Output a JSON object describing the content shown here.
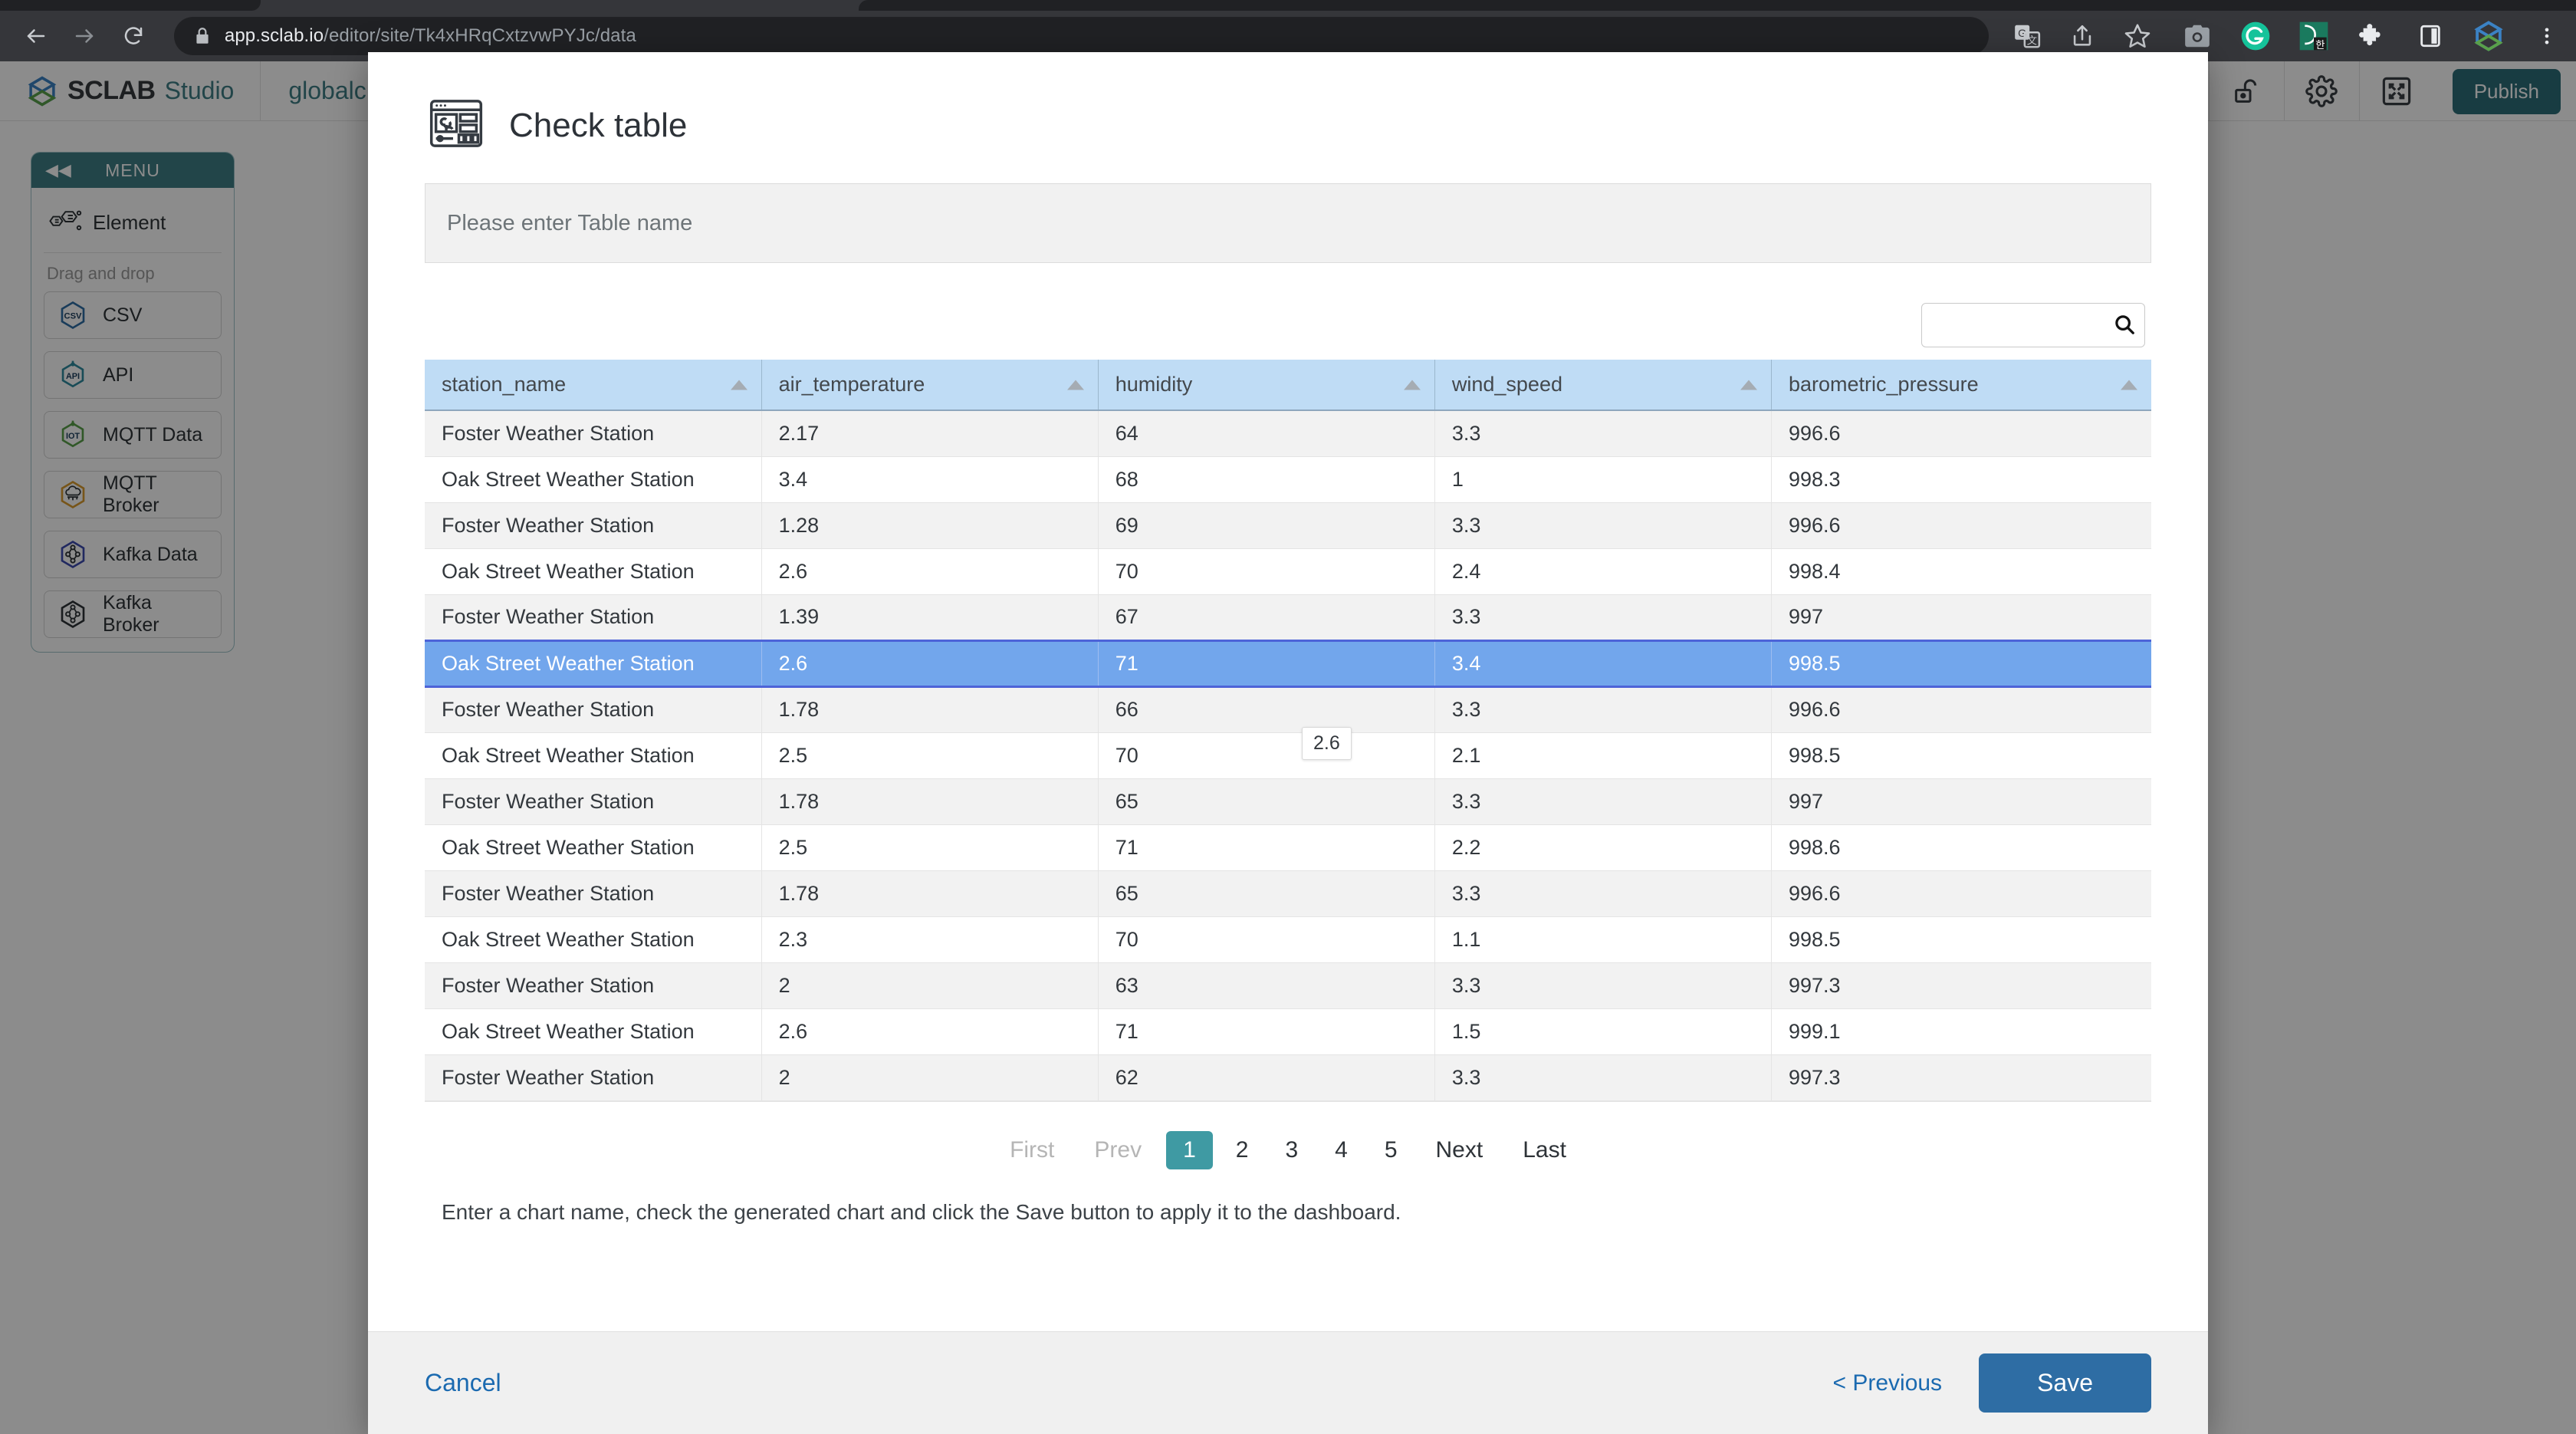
{
  "browser": {
    "url_host": "app.sclab.io",
    "url_path": "/editor/site/Tk4xHRqCxtzvwPYJc/data",
    "nav": {
      "back": "←",
      "forward": "→",
      "reload": "⟳"
    },
    "icons": {
      "lock": "lock-icon",
      "translate": "translate-icon",
      "share": "share-icon",
      "bookmark": "star-icon",
      "screenshot": "camera-icon",
      "grammarly": "grammarly-icon",
      "korean": "korean-ime-icon",
      "extensions": "puzzle-icon",
      "sidepanel": "side-panel-icon",
      "sclab": "sclab-logo-icon",
      "menu": "kebab-menu-icon"
    }
  },
  "app": {
    "brand_name": "SCLAB",
    "brand_sub": "Studio",
    "site_name": "globalc",
    "publish_label": "Publish",
    "header_icons": [
      "share-icon",
      "unlock-icon",
      "gear-icon",
      "fullscreen-icon"
    ]
  },
  "menu": {
    "title": "MENU",
    "collapse_icon": "◀◀",
    "element_label": "Element",
    "drag_label": "Drag and drop",
    "items": [
      {
        "label": "CSV",
        "icon": "csv-hex-icon",
        "color": "#2e6da4"
      },
      {
        "label": "API",
        "icon": "api-hex-icon",
        "color": "#2e8a9e"
      },
      {
        "label": "MQTT Data",
        "icon": "iot-hex-icon",
        "color": "#5aa04a"
      },
      {
        "label": "MQTT Broker",
        "icon": "mqtt-broker-hex-icon",
        "color": "#d99b2e"
      },
      {
        "label": "Kafka Data",
        "icon": "kafka-hex-icon",
        "color": "#3d4bb0"
      },
      {
        "label": "Kafka Broker",
        "icon": "kafka-hex-icon",
        "color": "#2e3338"
      }
    ]
  },
  "modal": {
    "title": "Check table",
    "title_icon": "dashboard-layout-icon",
    "table_name_placeholder": "Please enter Table name",
    "table_name_value": "",
    "search_placeholder": "",
    "search_value": "",
    "search_icon": "search-icon",
    "helper_text": "Enter a chart name, check the generated chart and click the Save button to apply it to the dashboard.",
    "tooltip_value": "2.6",
    "footer": {
      "cancel_label": "Cancel",
      "previous_label": "< Previous",
      "save_label": "Save"
    }
  },
  "table": {
    "columns": [
      "station_name",
      "air_temperature",
      "humidity",
      "wind_speed",
      "barometric_pressure"
    ],
    "selected_row_index": 5,
    "rows": [
      [
        "Foster Weather Station",
        "2.17",
        "64",
        "3.3",
        "996.6"
      ],
      [
        "Oak Street Weather Station",
        "3.4",
        "68",
        "1",
        "998.3"
      ],
      [
        "Foster Weather Station",
        "1.28",
        "69",
        "3.3",
        "996.6"
      ],
      [
        "Oak Street Weather Station",
        "2.6",
        "70",
        "2.4",
        "998.4"
      ],
      [
        "Foster Weather Station",
        "1.39",
        "67",
        "3.3",
        "997"
      ],
      [
        "Oak Street Weather Station",
        "2.6",
        "71",
        "3.4",
        "998.5"
      ],
      [
        "Foster Weather Station",
        "1.78",
        "66",
        "3.3",
        "996.6"
      ],
      [
        "Oak Street Weather Station",
        "2.5",
        "70",
        "2.1",
        "998.5"
      ],
      [
        "Foster Weather Station",
        "1.78",
        "65",
        "3.3",
        "997"
      ],
      [
        "Oak Street Weather Station",
        "2.5",
        "71",
        "2.2",
        "998.6"
      ],
      [
        "Foster Weather Station",
        "1.78",
        "65",
        "3.3",
        "996.6"
      ],
      [
        "Oak Street Weather Station",
        "2.3",
        "70",
        "1.1",
        "998.5"
      ],
      [
        "Foster Weather Station",
        "2",
        "63",
        "3.3",
        "997.3"
      ],
      [
        "Oak Street Weather Station",
        "2.6",
        "71",
        "1.5",
        "999.1"
      ],
      [
        "Foster Weather Station",
        "2",
        "62",
        "3.3",
        "997.3"
      ]
    ]
  },
  "pagination": {
    "first_label": "First",
    "prev_label": "Prev",
    "pages": [
      "1",
      "2",
      "3",
      "4",
      "5"
    ],
    "active_page": "1",
    "next_label": "Next",
    "last_label": "Last"
  },
  "colors": {
    "brand_teal": "#3f7f86",
    "publish_teal": "#2d6e78",
    "table_header_blue": "#bfdcf5",
    "row_selected_blue": "#72a6ec",
    "row_selected_border": "#4d63d8",
    "save_blue": "#2e6da4",
    "link_blue": "#1b6ab0",
    "page_active_teal": "#3f9aa3"
  }
}
